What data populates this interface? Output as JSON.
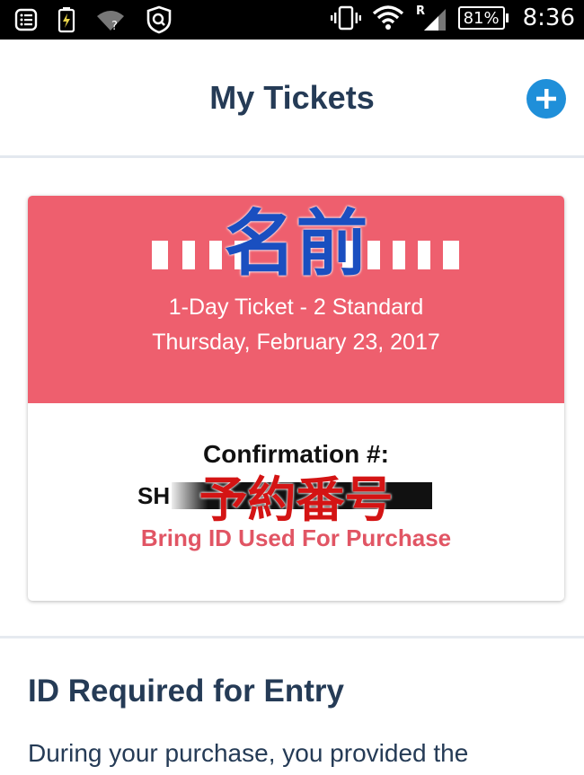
{
  "status_bar": {
    "icons_left": [
      "notes-icon",
      "battery-saver-icon",
      "wifi-unknown-icon",
      "security-shield-icon"
    ],
    "icons_right": [
      "vibrate-icon",
      "wifi-icon",
      "signal-icon"
    ],
    "signal_badge": "R",
    "battery_percent": "81%",
    "time": "8:36"
  },
  "header": {
    "title": "My Tickets",
    "add_icon": "plus-circle-icon",
    "accent_color": "#1f8fd9"
  },
  "ticket": {
    "name_overlay": "名前",
    "ticket_type": "1-Day Ticket - 2 Standard",
    "date": "Thursday, February 23, 2017",
    "confirmation_label": "Confirmation #:",
    "confirmation_prefix": "SH",
    "confirmation_overlay": "予約番号",
    "bring_id": "Bring ID Used For Purchase",
    "top_color": "#ee5f6e"
  },
  "id_section": {
    "heading": "ID Required for Entry",
    "body": "During your purchase, you provided the"
  }
}
